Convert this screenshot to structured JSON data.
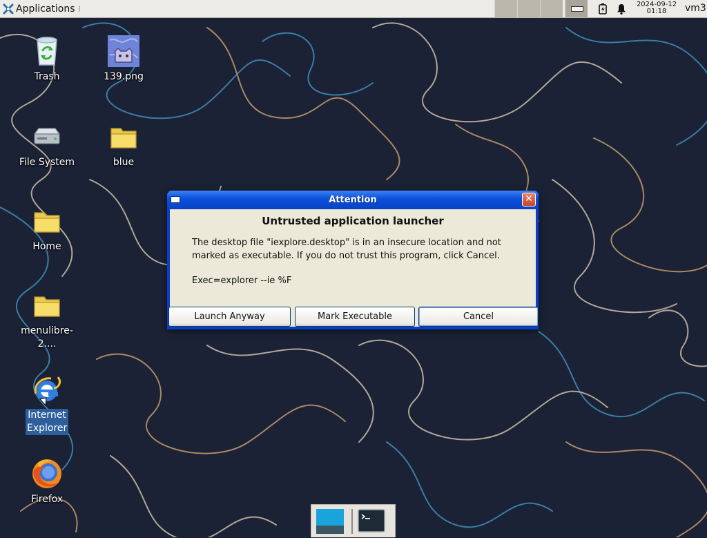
{
  "panel": {
    "applications_label": "Applications",
    "clock_date": "2024-09-12",
    "clock_time": "01:18",
    "user": "vm3"
  },
  "desktop": {
    "icons": [
      {
        "label": "Trash",
        "icon": "trash-icon"
      },
      {
        "label": "139.png",
        "icon": "image-file-icon"
      },
      {
        "label": "File System",
        "icon": "drive-icon"
      },
      {
        "label": "blue",
        "icon": "folder-icon"
      },
      {
        "label": "Home",
        "icon": "folder-icon"
      },
      {
        "label": "menulibre-2....",
        "icon": "folder-icon"
      },
      {
        "label": "Internet Explorer",
        "icon": "internet-explorer-icon"
      },
      {
        "label": "Firefox",
        "icon": "firefox-icon"
      }
    ]
  },
  "dialog": {
    "title": "Attention",
    "heading": "Untrusted application launcher",
    "message": "The desktop file \"iexplore.desktop\" is in an insecure location and not marked as executable. If you do not trust this program, click Cancel.",
    "exec": "Exec=explorer --ie %F",
    "buttons": {
      "launch": "Launch Anyway",
      "mark": "Mark Executable",
      "cancel": "Cancel"
    }
  },
  "dock": {
    "items": [
      "show-desktop-icon",
      "terminal-icon"
    ]
  },
  "colors": {
    "wallpaper": "#1b2236",
    "titlebar": "#0a4fd9",
    "dialog_body": "#ece9d8",
    "panel": "#ecebe6"
  }
}
